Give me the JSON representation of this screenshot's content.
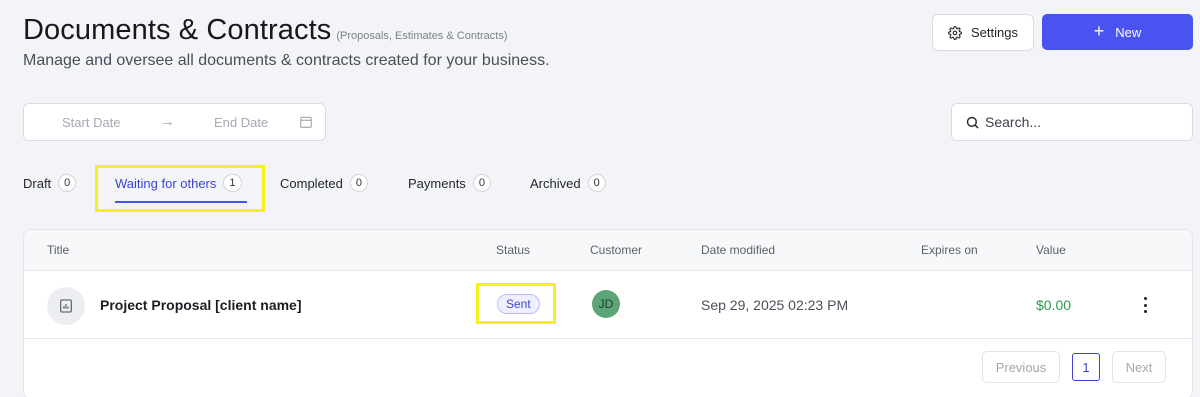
{
  "header": {
    "title": "Documents & Contracts",
    "title_tag": "(Proposals, Estimates & Contracts)",
    "description": "Manage and oversee all documents & contracts created for your business.",
    "settings_label": "Settings",
    "new_label": "New"
  },
  "filters": {
    "start_date_placeholder": "Start Date",
    "end_date_placeholder": "End Date",
    "search_placeholder": "Search..."
  },
  "tabs": [
    {
      "label": "Draft",
      "count": "0"
    },
    {
      "label": "Waiting for others",
      "count": "1",
      "active": true
    },
    {
      "label": "Completed",
      "count": "0"
    },
    {
      "label": "Payments",
      "count": "0"
    },
    {
      "label": "Archived",
      "count": "0"
    }
  ],
  "table": {
    "columns": [
      "Title",
      "Status",
      "Customer",
      "Date modified",
      "Expires on",
      "Value"
    ],
    "rows": [
      {
        "title": "Project Proposal [client name]",
        "status": "Sent",
        "customer_initials": "JD",
        "date_modified": "Sep 29, 2025 02:23 PM",
        "expires_on": "",
        "value": "$0.00"
      }
    ]
  },
  "pagination": {
    "previous_label": "Previous",
    "current_page": "1",
    "next_label": "Next"
  },
  "colors": {
    "accent": "#4a53f0",
    "highlight": "#f4f21a",
    "value_green": "#2f9a4b",
    "avatar_green": "#5ea576"
  },
  "icons": [
    "gear-icon",
    "plus-icon",
    "arrow-right-icon",
    "calendar-icon",
    "search-icon",
    "document-chart-icon",
    "kebab-menu-icon"
  ]
}
